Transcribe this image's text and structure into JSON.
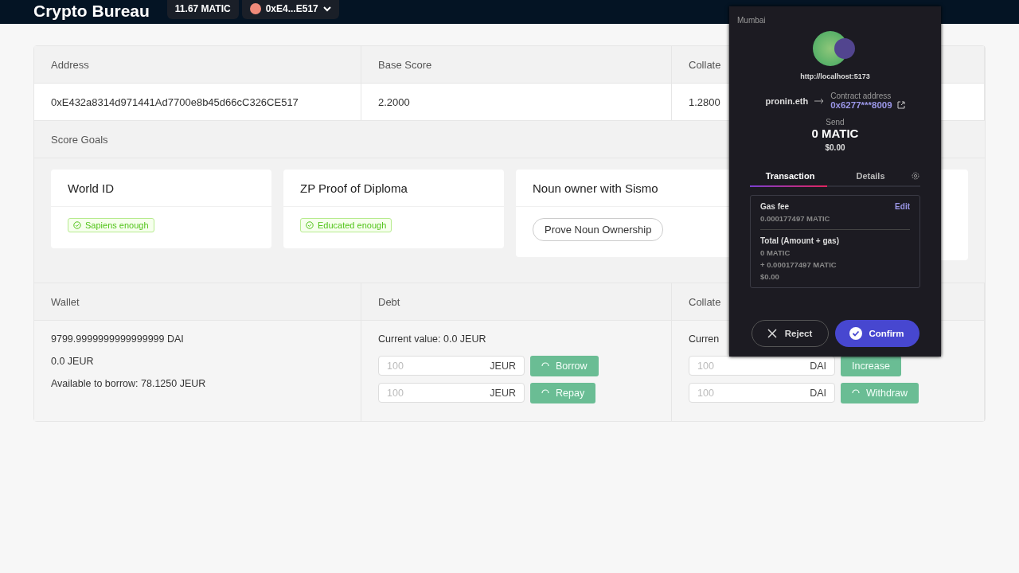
{
  "header": {
    "title": "Crypto Bureau",
    "balance": "11.67 MATIC",
    "account": "0xE4...E517"
  },
  "summary": {
    "columns": [
      "Address",
      "Base Score",
      "Collate"
    ],
    "values": [
      "0xE432a8314d971441Ad7700e8b45d66cC326CE517",
      "2.2000",
      "1.2800"
    ]
  },
  "score_goals": {
    "title": "Score Goals",
    "cards": [
      {
        "kind": "badge",
        "title": "World ID",
        "badge": "Sapiens enough"
      },
      {
        "kind": "badge",
        "title": "ZP Proof of Diploma",
        "badge": "Educated enough"
      },
      {
        "kind": "button",
        "title": "Noun owner with Sismo",
        "button": "Prove Noun Ownership"
      },
      {
        "kind": "empty"
      }
    ]
  },
  "positions": {
    "columns": [
      "Wallet",
      "Debt",
      "Collate"
    ],
    "wallet": [
      "9799.9999999999999999 DAI",
      "0.0 JEUR",
      "Available to borrow: 78.1250 JEUR"
    ],
    "debt": {
      "current": "Current value: 0.0 JEUR",
      "actions": [
        {
          "placeholder": "100",
          "unit": "JEUR",
          "button": "Borrow",
          "loading": true
        },
        {
          "placeholder": "100",
          "unit": "JEUR",
          "button": "Repay",
          "loading": true
        }
      ]
    },
    "collateral": {
      "current": "Curren",
      "actions": [
        {
          "placeholder": "100",
          "unit": "DAI",
          "button": "Increase",
          "loading": false
        },
        {
          "placeholder": "100",
          "unit": "DAI",
          "button": "Withdraw",
          "loading": true
        }
      ]
    }
  },
  "popup": {
    "network": "Mumbai",
    "origin": "http://localhost:5173",
    "from": "pronin.eth",
    "contract_label": "Contract address",
    "contract": "0x6277***8009",
    "send_label": "Send",
    "amount": "0 MATIC",
    "fiat": "$0.00",
    "tabs": [
      {
        "label": "Transaction",
        "selected": true
      },
      {
        "label": "Details",
        "selected": false
      }
    ],
    "gas_label": "Gas fee",
    "edit": "Edit",
    "gas_value": "0.000177497 MATIC",
    "total_label": "Total (Amount + gas)",
    "total_lines": [
      "0 MATIC",
      "+ 0.000177497 MATIC",
      "$0.00"
    ],
    "reject": "Reject",
    "confirm": "Confirm"
  }
}
